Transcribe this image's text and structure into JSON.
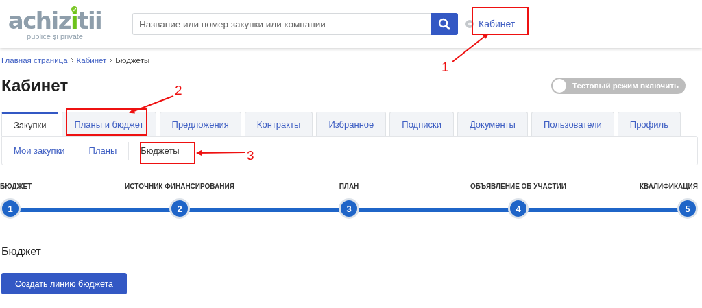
{
  "header": {
    "logo": {
      "word": "achizitii",
      "tagline": "publice și private"
    },
    "search": {
      "placeholder": "Название или номер закупки или компании"
    },
    "account_link": "Кабинет"
  },
  "breadcrumb": [
    "Главная страница",
    "Кабинет",
    "Бюджеты"
  ],
  "title": "Кабинет",
  "test_mode": {
    "label": "Тестовый режим включить",
    "on": false
  },
  "tabs": [
    {
      "label": "Закупки",
      "selected": true
    },
    {
      "label": "Планы и бюджет",
      "selected": false
    },
    {
      "label": "Предложения",
      "selected": false
    },
    {
      "label": "Контракты",
      "selected": false
    },
    {
      "label": "Избранное",
      "selected": false
    },
    {
      "label": "Подписки",
      "selected": false
    },
    {
      "label": "Документы",
      "selected": false
    },
    {
      "label": "Пользователи",
      "selected": false
    },
    {
      "label": "Профиль",
      "selected": false
    }
  ],
  "subtabs": [
    {
      "label": "Мои закупки",
      "selected": false
    },
    {
      "label": "Планы",
      "selected": false
    },
    {
      "label": "Бюджеты",
      "selected": true
    }
  ],
  "steps": [
    {
      "label": "БЮДЖЕТ",
      "number": "1"
    },
    {
      "label": "ИСТОЧНИК ФИНАНСИРОВАНИЯ",
      "number": "2"
    },
    {
      "label": "ПЛАН",
      "number": "3"
    },
    {
      "label": "ОБЪЯВЛЕНИЕ ОБ УЧАСТИИ",
      "number": "4"
    },
    {
      "label": "КВАЛИФИКАЦИЯ",
      "number": "5"
    }
  ],
  "section_title": "Бюджет",
  "create_button": "Создать линию бюджета",
  "annotations": [
    {
      "label": "1"
    },
    {
      "label": "2"
    },
    {
      "label": "3"
    }
  ]
}
